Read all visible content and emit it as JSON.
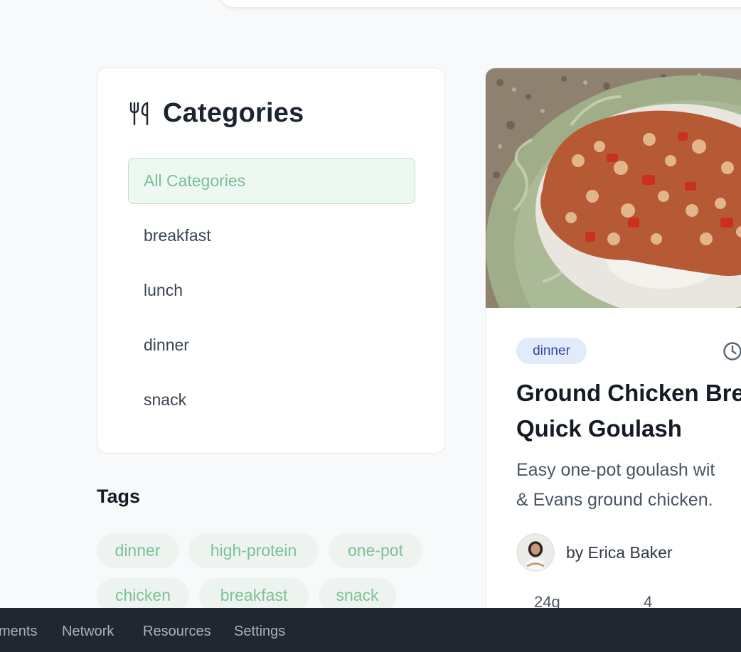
{
  "categories": {
    "title": "Categories",
    "icon": "utensils-icon",
    "items": [
      {
        "label": "All Categories",
        "active": true
      },
      {
        "label": "breakfast",
        "active": false
      },
      {
        "label": "lunch",
        "active": false
      },
      {
        "label": "dinner",
        "active": false
      },
      {
        "label": "snack",
        "active": false
      }
    ]
  },
  "tags": {
    "title": "Tags",
    "items": [
      "dinner",
      "high-protein",
      "one-pot",
      "chicken",
      "breakfast",
      "snack"
    ]
  },
  "recipe": {
    "badge": "dinner",
    "title": "Ground Chicken Bre\nQuick Goulash",
    "description": "Easy one-pot goulash wit\n& Evans ground chicken.",
    "author": "by Erica Baker",
    "stats": [
      "24g",
      "4"
    ]
  },
  "devtools": {
    "tabs": [
      "ments",
      "Network",
      "Resources",
      "Settings"
    ]
  },
  "colors": {
    "accent_green": "#79c095",
    "badge_blue": "#2f4b9e",
    "devtools_bg": "#22262e"
  }
}
